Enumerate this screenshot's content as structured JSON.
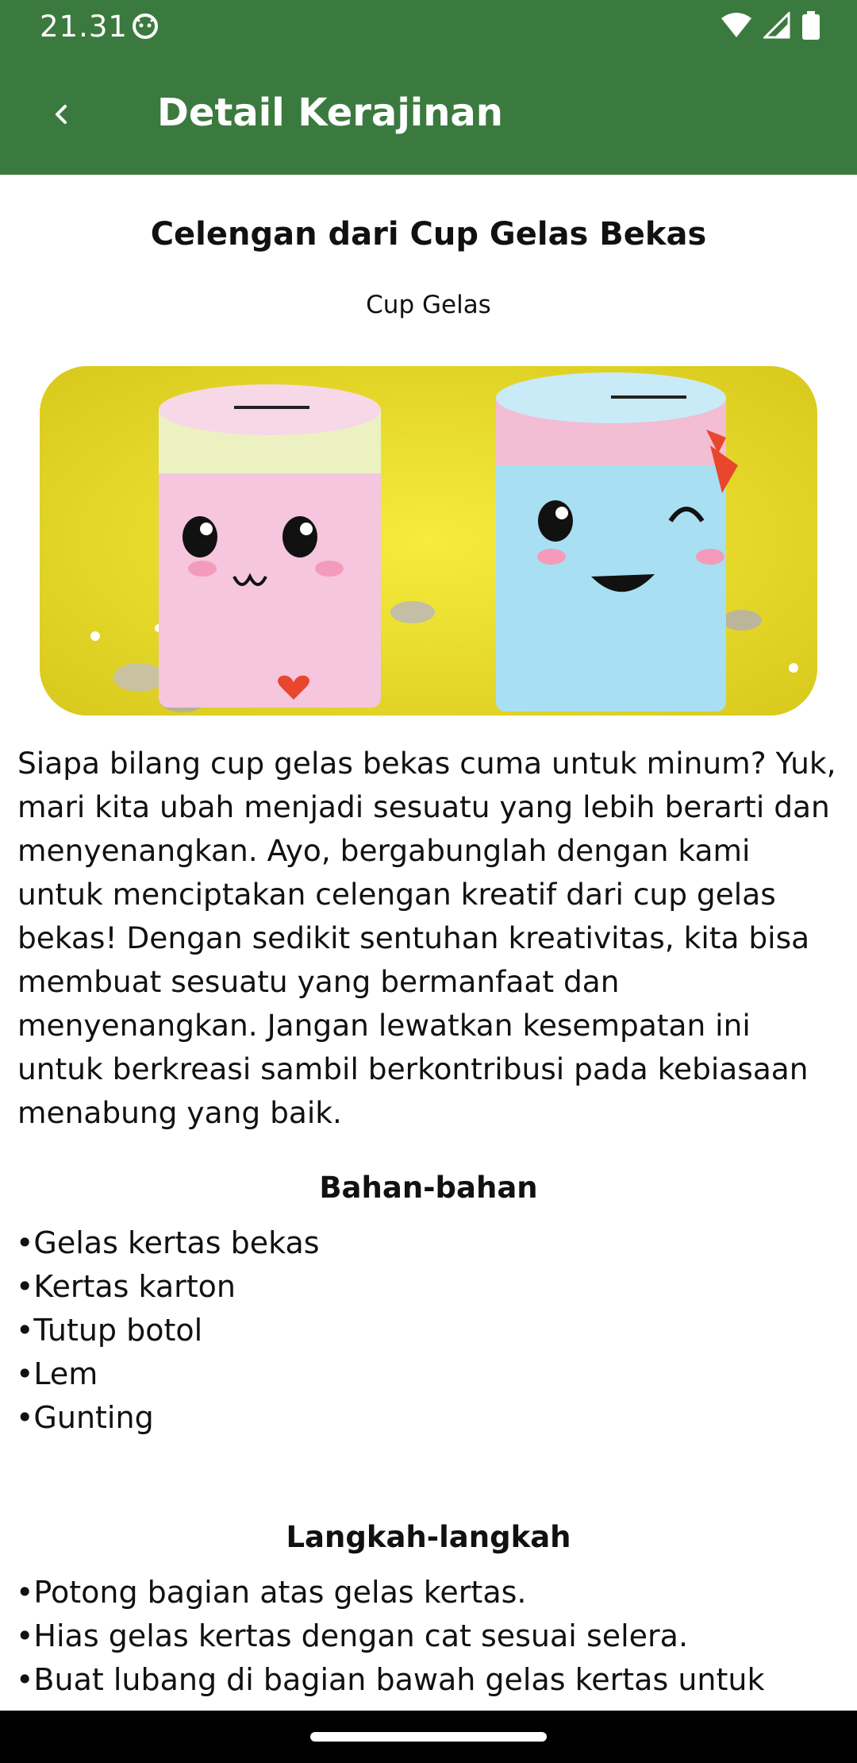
{
  "status_bar": {
    "time": "21.31",
    "icons": [
      "android-face-icon",
      "wifi-icon",
      "signal-icon",
      "battery-icon"
    ]
  },
  "app_bar": {
    "back_icon": "chevron-left-icon",
    "title": "Detail Kerajinan"
  },
  "craft": {
    "title": "Celengan dari Cup Gelas Bekas",
    "category": "Cup Gelas",
    "description": "Siapa bilang cup gelas bekas cuma untuk minum? Yuk, mari kita ubah menjadi sesuatu yang lebih berarti dan menyenangkan. Ayo, bergabunglah dengan kami untuk menciptakan celengan kreatif dari cup gelas bekas! Dengan sedikit sentuhan kreativitas, kita bisa membuat sesuatu yang bermanfaat dan menyenangkan. Jangan lewatkan kesempatan ini untuk berkreasi sambil berkontribusi pada kebiasaan menabung yang baik."
  },
  "materials": {
    "heading": "Bahan-bahan",
    "items": [
      "•Gelas kertas bekas",
      "•Kertas karton",
      "•Tutup botol",
      "•Lem",
      "•Gunting"
    ]
  },
  "steps": {
    "heading": "Langkah-langkah",
    "items": [
      "•Potong bagian atas gelas kertas.",
      "•Hias gelas kertas dengan cat sesuai selera.",
      "•Buat lubang di bagian bawah gelas kertas untuk"
    ]
  },
  "colors": {
    "primary": "#3b7a3e",
    "image_background": "#efe02a",
    "pink_cup": "#f5c6dd",
    "blue_cup": "#a9dff2"
  }
}
